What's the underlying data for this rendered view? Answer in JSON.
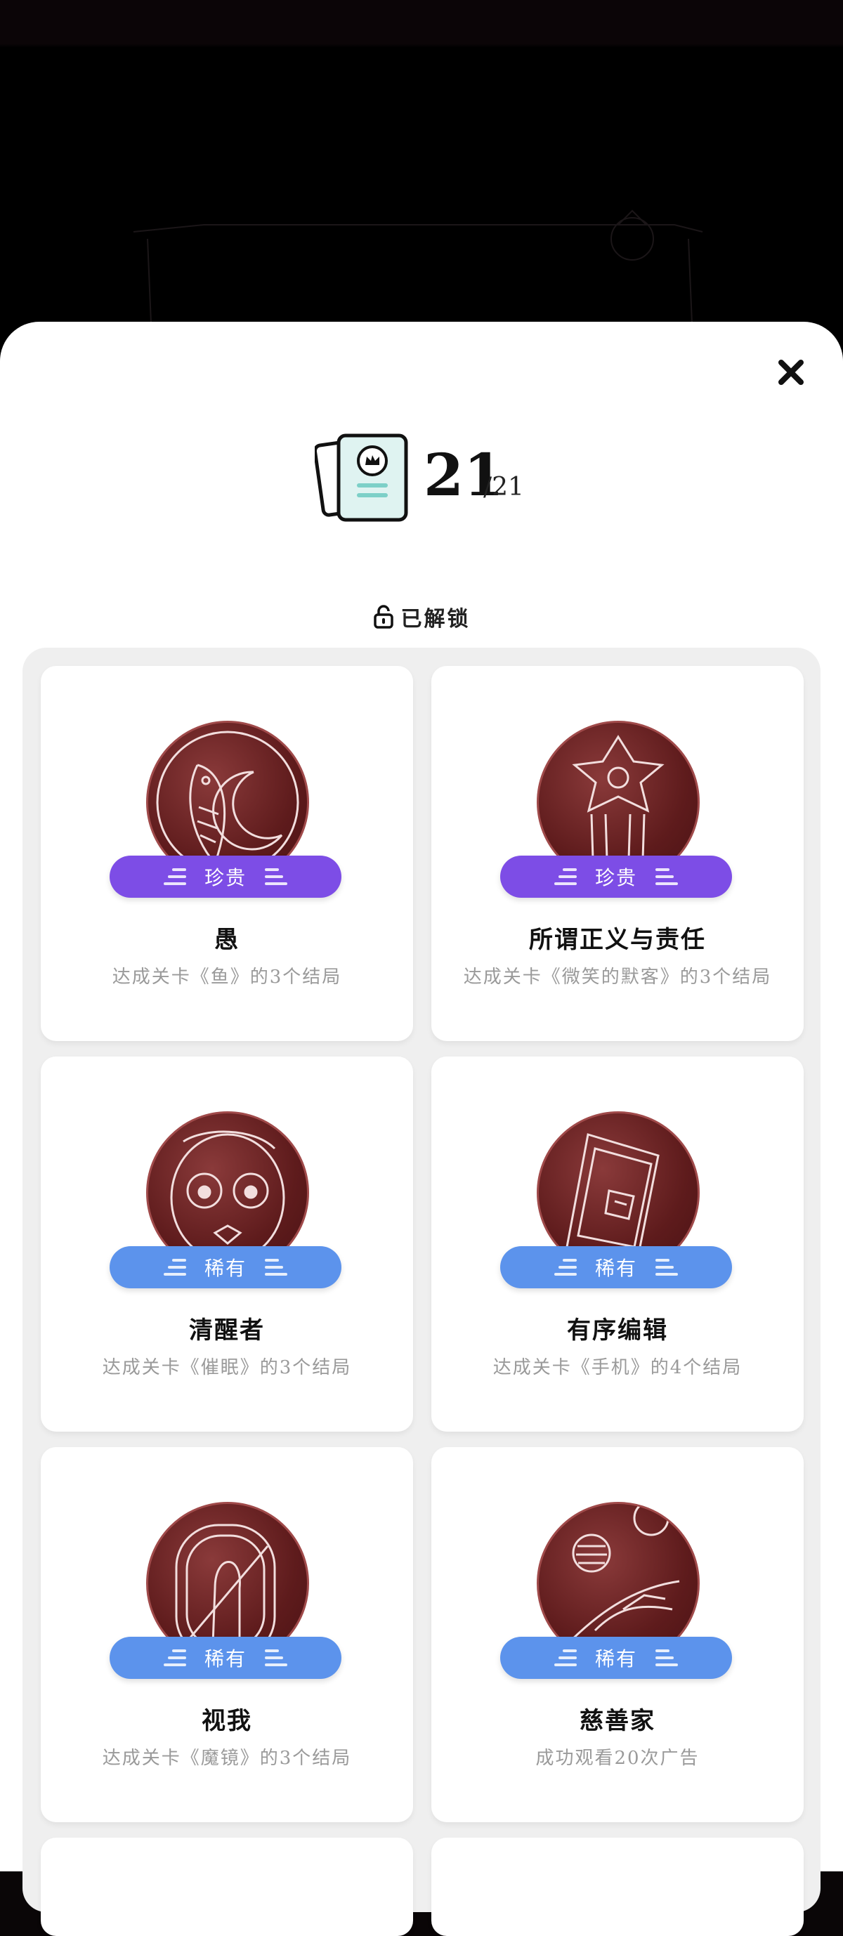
{
  "counter": {
    "unlocked": "21",
    "total": "/21"
  },
  "section": {
    "unlock_label": "已解锁"
  },
  "colors": {
    "precious": "#7d4de6",
    "rare": "#5c93ec",
    "medal": "#5e1b1c"
  },
  "achievements": [
    {
      "title": "愚",
      "rarity": "珍贵",
      "description": "达成关卡《鱼》的3个结局",
      "icon": "fish-moon-medal-icon"
    },
    {
      "title": "所谓正义与责任",
      "rarity": "珍贵",
      "description": "达成关卡《微笑的默客》的3个结局",
      "icon": "sheriff-star-medal-icon"
    },
    {
      "title": "清醒者",
      "rarity": "稀有",
      "description": "达成关卡《催眠》的3个结局",
      "icon": "wide-eyed-face-medal-icon"
    },
    {
      "title": "有序编辑",
      "rarity": "稀有",
      "description": "达成关卡《手机》的4个结局",
      "icon": "phone-medal-icon"
    },
    {
      "title": "视我",
      "rarity": "稀有",
      "description": "达成关卡《魔镜》的3个结局",
      "icon": "mirror-medal-icon"
    },
    {
      "title": "慈善家",
      "rarity": "稀有",
      "description": "成功观看20次广告",
      "icon": "coin-hand-medal-icon"
    }
  ]
}
